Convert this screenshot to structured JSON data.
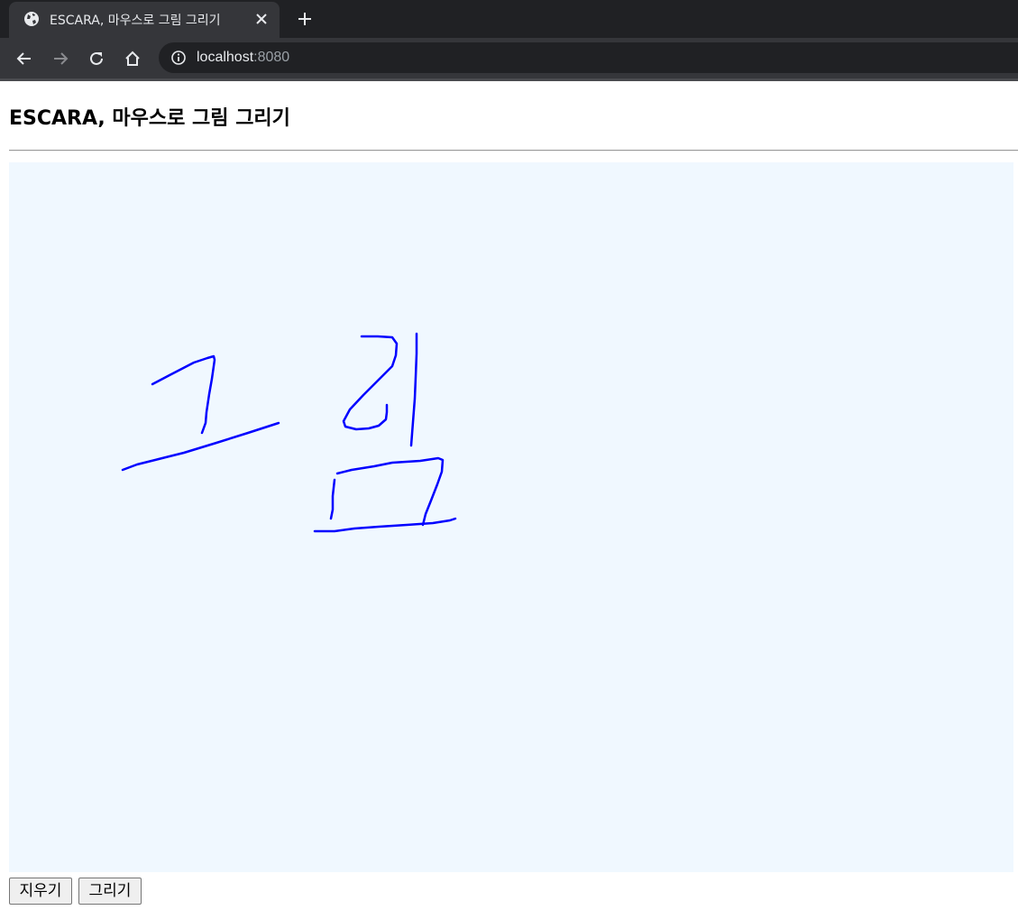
{
  "browser": {
    "tab": {
      "title": "ESCARA, 마우스로 그림 그리기",
      "favicon": "globe-icon",
      "close_icon": "close-icon"
    },
    "new_tab_icon": "plus-icon",
    "nav": {
      "back_icon": "back-arrow-icon",
      "forward_icon": "forward-arrow-icon",
      "reload_icon": "reload-icon",
      "home_icon": "home-icon"
    },
    "address": {
      "info_icon": "info-icon",
      "host": "localhost",
      "port": ":8080"
    }
  },
  "page": {
    "heading": "ESCARA, 마우스로 그림 그리기",
    "canvas": {
      "background": "#f0f8ff",
      "stroke_color": "#0000ff"
    },
    "buttons": {
      "erase_label": "지우기",
      "draw_label": "그리기"
    }
  }
}
